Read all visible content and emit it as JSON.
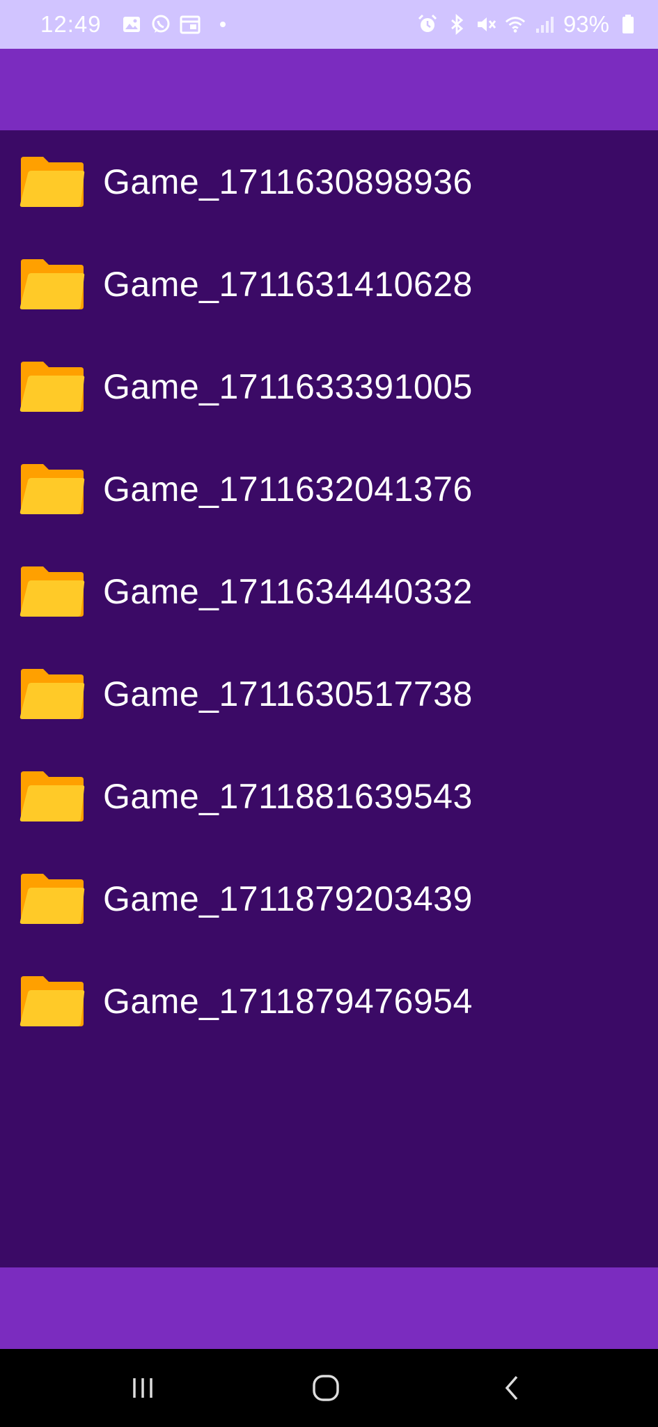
{
  "status_bar": {
    "time": "12:49",
    "battery": "93%",
    "icons_left": [
      "gallery-icon",
      "whatsapp-icon",
      "calendar-icon",
      "dot-icon"
    ],
    "icons_right": [
      "alarm-icon",
      "bluetooth-icon",
      "mute-icon",
      "wifi-icon",
      "signal-icon",
      "battery-icon"
    ]
  },
  "folders": [
    {
      "name": "Game_1711630898936"
    },
    {
      "name": "Game_1711631410628"
    },
    {
      "name": "Game_1711633391005"
    },
    {
      "name": "Game_1711632041376"
    },
    {
      "name": "Game_1711634440332"
    },
    {
      "name": "Game_1711630517738"
    },
    {
      "name": "Game_1711881639543"
    },
    {
      "name": "Game_1711879203439"
    },
    {
      "name": "Game_1711879476954"
    }
  ],
  "colors": {
    "status_bar": "#d1c4ff",
    "app_bar": "#7b2cbf",
    "list_background": "#3b0a66",
    "folder_back": "#ffa000",
    "folder_front": "#ffca28",
    "nav_bar": "#000000"
  },
  "nav": {
    "recent_icon": "recent-apps-icon",
    "home_icon": "home-icon",
    "back_icon": "back-icon"
  }
}
